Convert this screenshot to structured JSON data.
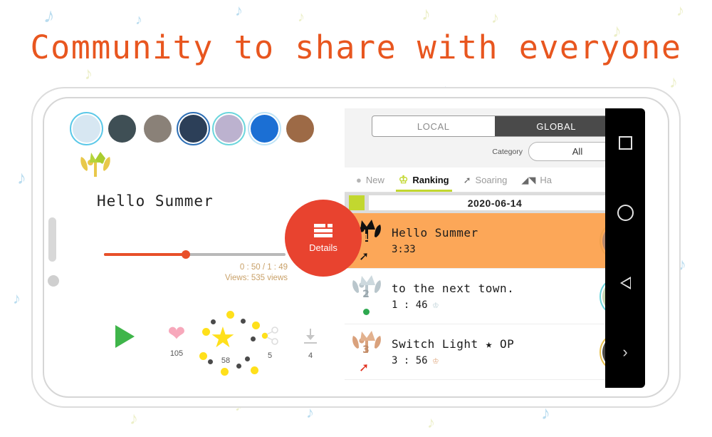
{
  "headline": "Community to share with everyone",
  "colors": {
    "headline": "#e8561f",
    "accent_red": "#e8432f",
    "accent_green": "#c2d72f",
    "highlight_orange": "#fca758",
    "play_green": "#3fb54a",
    "star_yellow": "#ffe01b",
    "heart_pink": "#f7a8bb",
    "meta_tan": "#c9a169"
  },
  "player": {
    "stories": [
      {
        "name": "story-avatar-1",
        "ring": "#5bc8e8",
        "img": "#d7e7f2"
      },
      {
        "name": "story-avatar-2",
        "ring": "#ffffff",
        "img": "#3f4f55"
      },
      {
        "name": "story-avatar-3",
        "ring": "#ffffff",
        "img": "#8a8178"
      },
      {
        "name": "story-avatar-4",
        "ring": "#2e6fb5",
        "img": "#2c3f58"
      },
      {
        "name": "story-avatar-5",
        "ring": "#6cd6dd",
        "img": "#bcb2cf"
      },
      {
        "name": "story-avatar-6",
        "ring": "#bfe4f7",
        "img": "#1b6fd4"
      },
      {
        "name": "story-avatar-7",
        "ring": "#ffffff",
        "img": "#9d6a46"
      }
    ],
    "badge_icon": "laurel-crown-icon",
    "title": "Hello Summer",
    "progress_percent": 45,
    "time": "0 : 50 / 1 : 49",
    "views": "Views:  535 views",
    "actions": {
      "play_icon": "play-icon",
      "like_icon": "heart-icon",
      "like_count": "105",
      "star_icon": "star-icon",
      "star_count": "58",
      "share_icon": "share-icon",
      "share_count": "5",
      "download_icon": "download-icon",
      "download_count": "4"
    },
    "details_button": {
      "label": "Details",
      "icon": "list-layout-icon"
    }
  },
  "ranking": {
    "segments": [
      {
        "label": "LOCAL",
        "active": false
      },
      {
        "label": "GLOBAL",
        "active": true
      }
    ],
    "category": {
      "label": "Category",
      "value": "All"
    },
    "tabs": [
      {
        "label": "New",
        "icon": "dot-icon",
        "active": false
      },
      {
        "label": "Ranking",
        "icon": "crown-icon",
        "active": true
      },
      {
        "label": "Soaring",
        "icon": "arrow-up-right-icon",
        "active": false
      },
      {
        "label": "Ha",
        "icon": "chart-icon",
        "active": false
      }
    ],
    "date": "2020-06-14",
    "items": [
      {
        "rank": "1",
        "rank_icon": "laurel-rank-1-icon",
        "title": "Hello Summer",
        "duration": "3:33",
        "crown": "",
        "trend": "arrow-up-black",
        "highlight": true,
        "avatar_ring": "#f0a24f",
        "avatar_img": "#b98a6d"
      },
      {
        "rank": "2",
        "rank_icon": "laurel-rank-2-icon",
        "title": "to the next town.",
        "duration": "1 : 46",
        "crown": "crown-silver-icon",
        "trend": "dot-green",
        "highlight": false,
        "avatar_ring": "#6cd6dd",
        "avatar_img": "#c8d8b4"
      },
      {
        "rank": "3",
        "rank_icon": "laurel-rank-3-icon",
        "title": "Switch Light ★ OP",
        "duration": "3 : 56",
        "crown": "crown-bronze-icon",
        "trend": "arrow-up-red",
        "highlight": false,
        "avatar_ring": "#e8c14f",
        "avatar_img": "#4e4b46"
      }
    ]
  },
  "navbar": {
    "recents": "square-recents-icon",
    "home": "circle-home-icon",
    "back": "triangle-back-icon",
    "expand": "chevron-right-icon"
  }
}
